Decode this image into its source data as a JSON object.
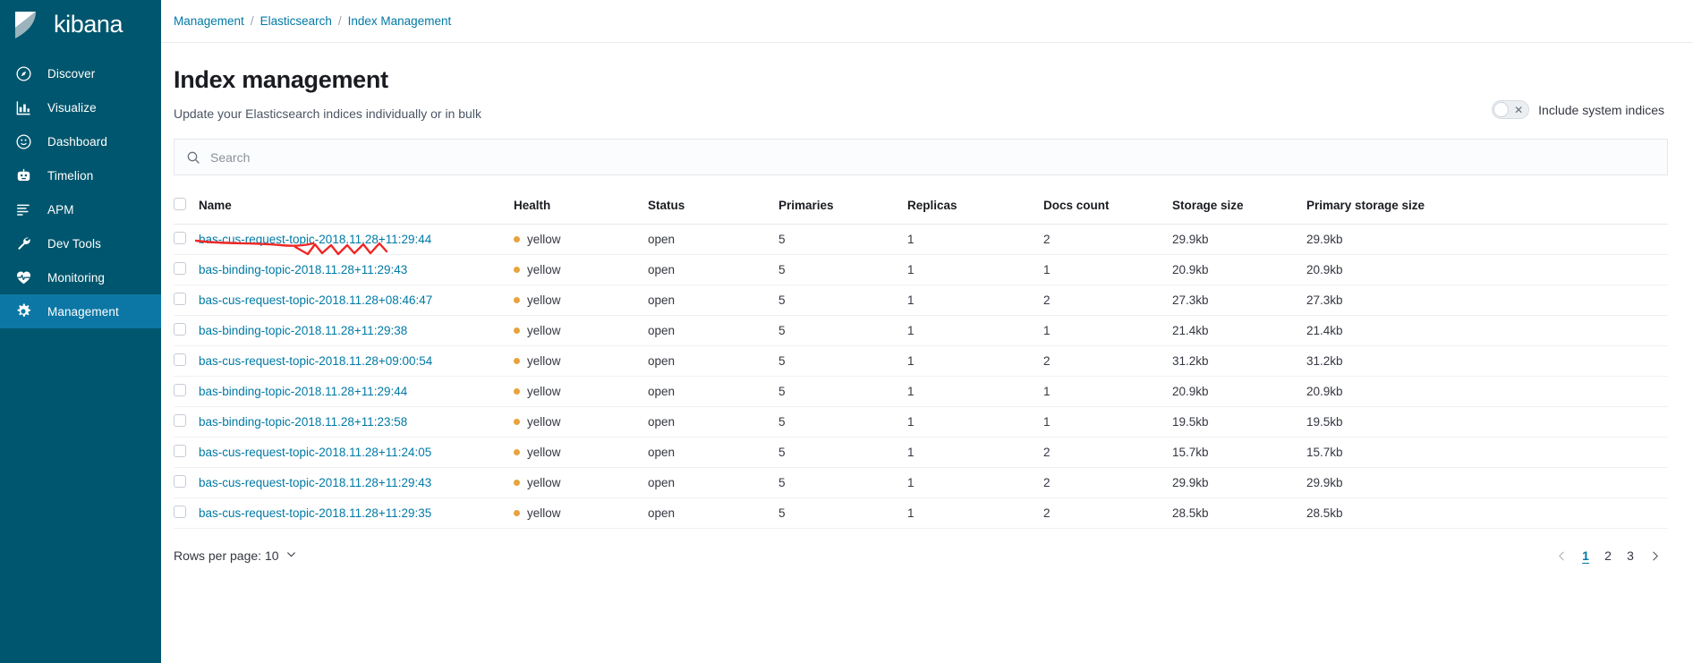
{
  "sidebar": {
    "brand": "kibana",
    "brand_logo_icon": "kibana-logo-icon",
    "items": [
      {
        "label": "Discover",
        "icon": "compass-icon",
        "active": false
      },
      {
        "label": "Visualize",
        "icon": "bar-chart-icon",
        "active": false
      },
      {
        "label": "Dashboard",
        "icon": "dashboard-icon",
        "active": false
      },
      {
        "label": "Timelion",
        "icon": "timelion-icon",
        "active": false
      },
      {
        "label": "APM",
        "icon": "apm-icon",
        "active": false
      },
      {
        "label": "Dev Tools",
        "icon": "wrench-icon",
        "active": false
      },
      {
        "label": "Monitoring",
        "icon": "heartbeat-icon",
        "active": false
      },
      {
        "label": "Management",
        "icon": "gear-icon",
        "active": true
      }
    ]
  },
  "breadcrumb": {
    "separator": "/",
    "items": [
      "Management",
      "Elasticsearch",
      "Index Management"
    ]
  },
  "page": {
    "title": "Index management",
    "subtitle": "Update your Elasticsearch indices individually or in bulk"
  },
  "system_indices_toggle": {
    "label": "Include system indices",
    "state": "off",
    "icon": "close-x-icon"
  },
  "search": {
    "placeholder": "Search",
    "value": "",
    "icon": "search-icon"
  },
  "table": {
    "columns": [
      "Name",
      "Health",
      "Status",
      "Primaries",
      "Replicas",
      "Docs count",
      "Storage size",
      "Primary storage size"
    ],
    "rows": [
      {
        "name": "bas-cus-request-topic-2018.11.28+11:29:44",
        "health": "yellow",
        "status": "open",
        "primaries": "5",
        "replicas": "1",
        "docs_count": "2",
        "storage_size": "29.9kb",
        "primary_storage_size": "29.9kb",
        "annotated": true
      },
      {
        "name": "bas-binding-topic-2018.11.28+11:29:43",
        "health": "yellow",
        "status": "open",
        "primaries": "5",
        "replicas": "1",
        "docs_count": "1",
        "storage_size": "20.9kb",
        "primary_storage_size": "20.9kb",
        "annotated": false
      },
      {
        "name": "bas-cus-request-topic-2018.11.28+08:46:47",
        "health": "yellow",
        "status": "open",
        "primaries": "5",
        "replicas": "1",
        "docs_count": "2",
        "storage_size": "27.3kb",
        "primary_storage_size": "27.3kb",
        "annotated": false
      },
      {
        "name": "bas-binding-topic-2018.11.28+11:29:38",
        "health": "yellow",
        "status": "open",
        "primaries": "5",
        "replicas": "1",
        "docs_count": "1",
        "storage_size": "21.4kb",
        "primary_storage_size": "21.4kb",
        "annotated": false
      },
      {
        "name": "bas-cus-request-topic-2018.11.28+09:00:54",
        "health": "yellow",
        "status": "open",
        "primaries": "5",
        "replicas": "1",
        "docs_count": "2",
        "storage_size": "31.2kb",
        "primary_storage_size": "31.2kb",
        "annotated": false
      },
      {
        "name": "bas-binding-topic-2018.11.28+11:29:44",
        "health": "yellow",
        "status": "open",
        "primaries": "5",
        "replicas": "1",
        "docs_count": "1",
        "storage_size": "20.9kb",
        "primary_storage_size": "20.9kb",
        "annotated": false
      },
      {
        "name": "bas-binding-topic-2018.11.28+11:23:58",
        "health": "yellow",
        "status": "open",
        "primaries": "5",
        "replicas": "1",
        "docs_count": "1",
        "storage_size": "19.5kb",
        "primary_storage_size": "19.5kb",
        "annotated": false
      },
      {
        "name": "bas-cus-request-topic-2018.11.28+11:24:05",
        "health": "yellow",
        "status": "open",
        "primaries": "5",
        "replicas": "1",
        "docs_count": "2",
        "storage_size": "15.7kb",
        "primary_storage_size": "15.7kb",
        "annotated": false
      },
      {
        "name": "bas-cus-request-topic-2018.11.28+11:29:43",
        "health": "yellow",
        "status": "open",
        "primaries": "5",
        "replicas": "1",
        "docs_count": "2",
        "storage_size": "29.9kb",
        "primary_storage_size": "29.9kb",
        "annotated": false
      },
      {
        "name": "bas-cus-request-topic-2018.11.28+11:29:35",
        "health": "yellow",
        "status": "open",
        "primaries": "5",
        "replicas": "1",
        "docs_count": "2",
        "storage_size": "28.5kb",
        "primary_storage_size": "28.5kb",
        "annotated": false
      }
    ]
  },
  "footer": {
    "rows_per_page_label": "Rows per page: 10",
    "rows_per_page_icon": "chevron-down-icon",
    "prev_icon": "chevron-left-icon",
    "next_icon": "chevron-right-icon",
    "pages": [
      "1",
      "2",
      "3"
    ],
    "active_page": "1"
  },
  "colors": {
    "sidebar_bg": "#00566e",
    "sidebar_active": "#0c77a4",
    "link": "#0079a5",
    "health_yellow_dot": "#e8a33d",
    "annotation_red": "#ef2727"
  }
}
